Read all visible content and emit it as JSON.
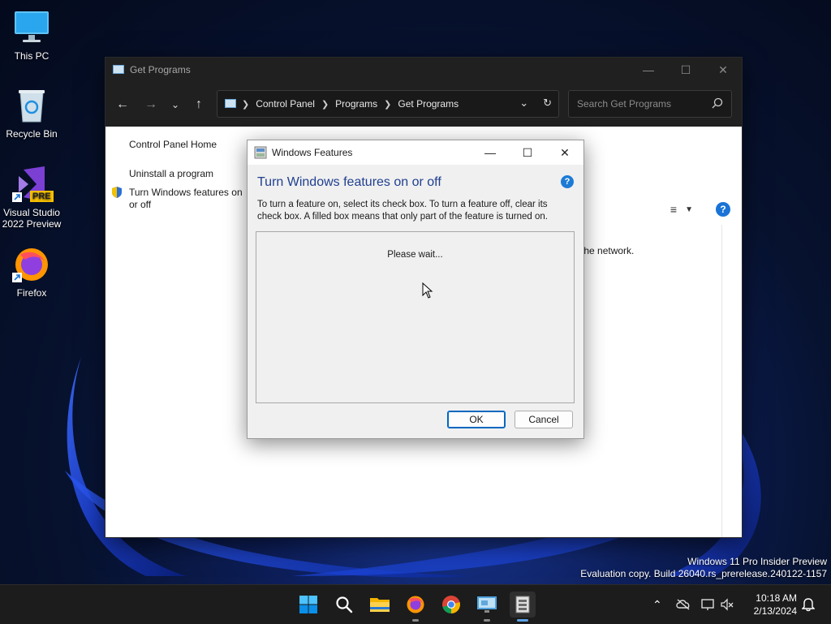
{
  "desktop": {
    "icons": [
      {
        "label": "This PC"
      },
      {
        "label": "Recycle Bin"
      },
      {
        "label": "Visual Studio 2022 Preview",
        "badge": "PRE"
      },
      {
        "label": "Firefox"
      }
    ]
  },
  "control_panel": {
    "title": "Get Programs",
    "breadcrumb": [
      "Control Panel",
      "Programs",
      "Get Programs"
    ],
    "search_placeholder": "Search Get Programs",
    "left_links": {
      "home": "Control Panel Home",
      "uninstall": "Uninstall a program",
      "features": "Turn Windows features on or off"
    },
    "body_text_fragment": "the network."
  },
  "windows_features": {
    "title": "Windows Features",
    "heading": "Turn Windows features on or off",
    "description": "To turn a feature on, select its check box. To turn a feature off, clear its check box. A filled box means that only part of the feature is turned on.",
    "status": "Please wait...",
    "ok_label": "OK",
    "cancel_label": "Cancel",
    "help_glyph": "?"
  },
  "watermark": {
    "line1": "Windows 11 Pro Insider Preview",
    "line2": "Evaluation copy. Build 26040.rs_prerelease.240122-1157"
  },
  "taskbar": {
    "apps": [
      "start-icon",
      "search-icon",
      "file-explorer-icon",
      "firefox-icon",
      "chrome-icon",
      "control-panel-icon",
      "windows-features-icon"
    ],
    "clock_time": "10:18 AM",
    "clock_date": "2/13/2024"
  },
  "colors": {
    "accent": "#0067c0",
    "heading_blue": "#1f3f8f",
    "titlebar_dark": "#202020"
  }
}
